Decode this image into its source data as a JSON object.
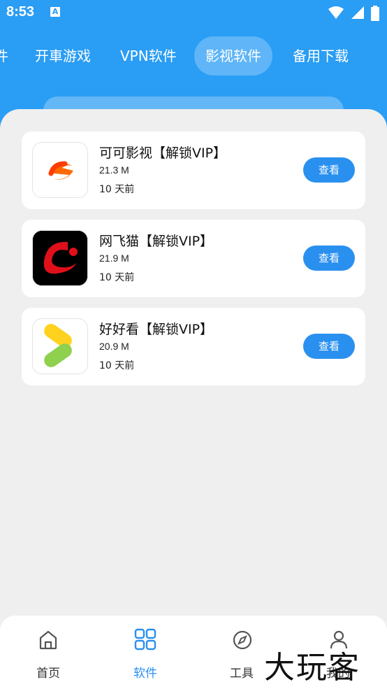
{
  "status": {
    "time": "8:53",
    "notification_badge": "A"
  },
  "tabs": [
    {
      "label": "件"
    },
    {
      "label": "开車游戏"
    },
    {
      "label": "VPN软件"
    },
    {
      "label": "影视软件"
    },
    {
      "label": "备用下载"
    }
  ],
  "active_tab": "影视软件",
  "apps": [
    {
      "title": "可可影视【解锁VIP】",
      "size": "21.3 M",
      "date": "10 天前",
      "button": "查看",
      "icon": "keke-icon"
    },
    {
      "title": "网飞猫【解锁VIP】",
      "size": "21.9 M",
      "date": "10 天前",
      "button": "查看",
      "icon": "wangfeimao-icon"
    },
    {
      "title": "好好看【解锁VIP】",
      "size": "20.9 M",
      "date": "10 天前",
      "button": "查看",
      "icon": "haohaokan-icon"
    }
  ],
  "bottom_nav": [
    {
      "label": "首页",
      "icon": "home-icon"
    },
    {
      "label": "软件",
      "icon": "grid-icon"
    },
    {
      "label": "工具",
      "icon": "compass-icon"
    },
    {
      "label": "我的",
      "icon": "user-icon"
    }
  ],
  "active_nav": "软件",
  "watermark": "大玩客",
  "colors": {
    "primary": "#2a9df4",
    "button": "#2a90f0",
    "background": "#efefef"
  }
}
